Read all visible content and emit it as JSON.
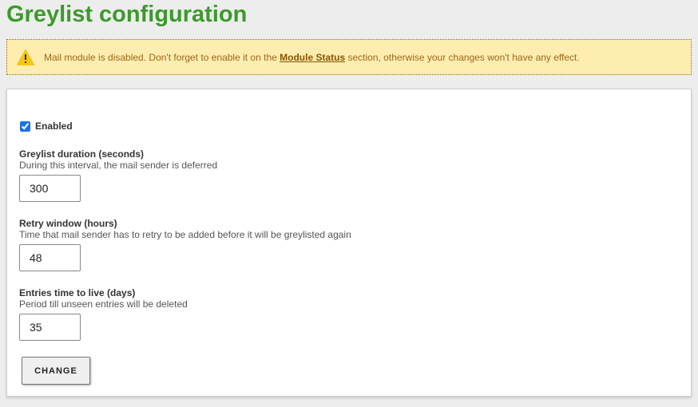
{
  "page": {
    "title": "Greylist configuration"
  },
  "warning": {
    "icon": "warning-icon",
    "text_before": "Mail module is disabled. Don't forget to enable it on the ",
    "link": "Module Status",
    "text_after": " section, otherwise your changes won't have any effect."
  },
  "form": {
    "enabled": {
      "label": "Enabled",
      "checked": true
    },
    "fields": [
      {
        "label": "Greylist duration (seconds)",
        "help": "During this interval, the mail sender is deferred",
        "value": "300"
      },
      {
        "label": "Retry window (hours)",
        "help": "Time that mail sender has to retry to be added before it will be greylisted again",
        "value": "48"
      },
      {
        "label": "Entries time to live (days)",
        "help": "Period till unseen entries will be deleted",
        "value": "35"
      }
    ],
    "submit_label": "CHANGE"
  }
}
